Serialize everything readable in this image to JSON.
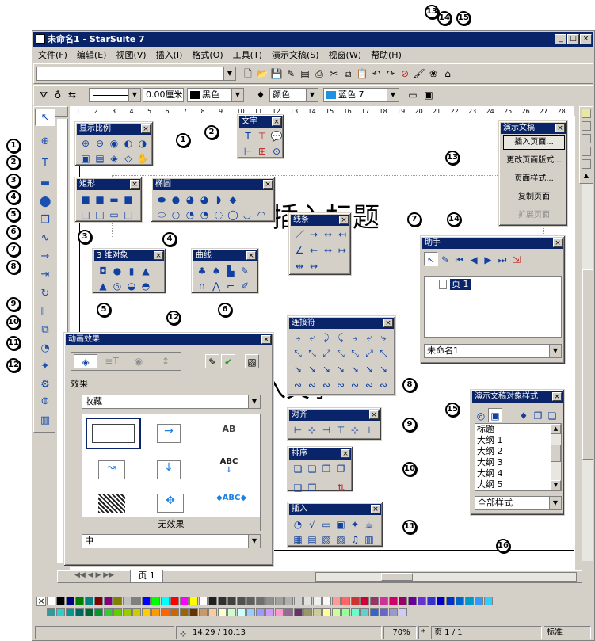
{
  "window": {
    "title": "未命名1 - StarSuite 7",
    "min": "_",
    "max": "□",
    "close": "×"
  },
  "menu": [
    "文件(F)",
    "编辑(E)",
    "视图(V)",
    "插入(I)",
    "格式(O)",
    "工具(T)",
    "演示文稿(S)",
    "视窗(W)",
    "帮助(H)"
  ],
  "format_bar": {
    "line_width": "0.00厘米",
    "line_color": "黑色",
    "area_type": "颜色",
    "area_color": "蓝色 7"
  },
  "ruler_numbers": [
    "1",
    "2",
    "3",
    "4",
    "5",
    "6",
    "7",
    "8",
    "9",
    "10",
    "11",
    "12",
    "13",
    "14",
    "15",
    "16",
    "17",
    "18",
    "19",
    "20",
    "21",
    "22",
    "23",
    "24",
    "25",
    "26",
    "27",
    "28"
  ],
  "slide": {
    "title_text": "插入标题",
    "body_text": "插入文字"
  },
  "panels": {
    "zoom": {
      "title": "显示比例"
    },
    "text": {
      "title": "文字"
    },
    "rect": {
      "title": "矩形"
    },
    "ellipse": {
      "title": "椭圆"
    },
    "lines": {
      "title": "线条"
    },
    "objects3d": {
      "title": "3 维对象"
    },
    "curves": {
      "title": "曲线"
    },
    "connectors": {
      "title": "连接符"
    },
    "align": {
      "title": "对齐"
    },
    "arrange": {
      "title": "排序"
    },
    "insert": {
      "title": "插入"
    },
    "presentation": {
      "title": "演示文稿",
      "items": [
        "插入页面...",
        "更改页面版式...",
        "页面样式...",
        "复制页面",
        "扩展页面"
      ]
    },
    "navigator": {
      "title": "助手",
      "tree_item": "页 1",
      "doc": "未命名1"
    },
    "styles": {
      "title": "演示文稿对象样式",
      "items": [
        "标题",
        "大纲 1",
        "大纲 2",
        "大纲 3",
        "大纲 4",
        "大纲 5"
      ],
      "filter": "全部样式"
    },
    "animation": {
      "title": "动画效果",
      "effects_label": "效果",
      "category": "收藏",
      "no_effect": "无效果",
      "speed": "中"
    }
  },
  "callouts": [
    "1",
    "2",
    "3",
    "4",
    "5",
    "6",
    "7",
    "8",
    "9",
    "10",
    "11",
    "12",
    "13",
    "14",
    "15",
    "16"
  ],
  "tabs": {
    "page": "页 1"
  },
  "status": {
    "coords": "14.29 / 10.13",
    "zoom": "70%",
    "marker": "*",
    "page": "页 1 / 1",
    "style": "标准"
  },
  "colors": {
    "title_bar": "#0a246a",
    "chrome": "#d4d0c8",
    "palette_row1": [
      "#ffffff",
      "#000000",
      "#000080",
      "#008000",
      "#008080",
      "#800000",
      "#800080",
      "#808000",
      "#c0c0c0",
      "#808080",
      "#0000ff",
      "#00ff00",
      "#00ffff",
      "#ff0000",
      "#ff00ff",
      "#ffff00",
      "#ffffff",
      "#202020",
      "#303030",
      "#404040",
      "#505050",
      "#606060",
      "#707070",
      "#909090",
      "#a0a0a0",
      "#b0b0b0",
      "#d0d0d0",
      "#e0e0e0",
      "#f0f0f0",
      "#f8f8f8",
      "#ff9999",
      "#ff6666",
      "#cc3333",
      "#cc0033",
      "#993366",
      "#cc3399",
      "#cc0066",
      "#990066",
      "#660099",
      "#6633cc",
      "#3333cc",
      "#0000cc",
      "#0033cc",
      "#0066cc",
      "#0099cc",
      "#3399ff",
      "#33ccff"
    ],
    "palette_row2": [
      "#339999",
      "#33cccc",
      "#009999",
      "#006666",
      "#006633",
      "#009933",
      "#33cc33",
      "#66cc00",
      "#99cc00",
      "#cccc00",
      "#ffcc00",
      "#ff9900",
      "#ff6600",
      "#cc6600",
      "#996600",
      "#663300",
      "#cc9966",
      "#ffcc99",
      "#ffffcc",
      "#ccffcc",
      "#ccffff",
      "#99ccff",
      "#9999ff",
      "#cc99ff",
      "#ff99cc",
      "#996699",
      "#663366",
      "#999966",
      "#cccc99",
      "#ffff99",
      "#ccff99",
      "#99ff99",
      "#66ffcc",
      "#66cccc",
      "#3366cc",
      "#6666cc",
      "#9999cc",
      "#ccccff"
    ]
  }
}
